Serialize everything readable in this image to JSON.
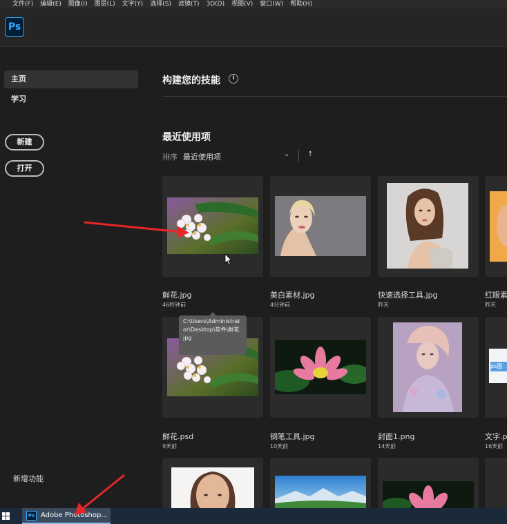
{
  "menu": {
    "items": [
      "文件(F)",
      "编辑(E)",
      "图像(I)",
      "图层(L)",
      "文字(Y)",
      "选择(S)",
      "滤镜(T)",
      "3D(D)",
      "视图(V)",
      "窗口(W)",
      "帮助(H)"
    ]
  },
  "app": {
    "logo_text": "Ps"
  },
  "sidebar": {
    "home": "主页",
    "learn": "学习",
    "new_button": "新建",
    "open_button": "打开",
    "whats_new": "新增功能"
  },
  "main": {
    "skills_heading": "构建您的技能",
    "info_glyph": "i",
    "recent_heading": "最近使用项",
    "sort_label": "排序",
    "sort_value": "最近使用项",
    "sort_chevron": "⌄",
    "sort_direction": "↑"
  },
  "recent_files": [
    {
      "name": "鲜花.jpg",
      "time": "46秒钟前"
    },
    {
      "name": "美白素材.jpg",
      "time": "4分钟前"
    },
    {
      "name": "快速选择工具.jpg",
      "time": "昨天"
    },
    {
      "name": "红眼素",
      "time": "昨天"
    },
    {
      "name": "鲜花.psd",
      "time": "9天前"
    },
    {
      "name": "钢笔工具.jpg",
      "time": "10天前"
    },
    {
      "name": "封面1.png",
      "time": "14天前"
    },
    {
      "name": "文字.p",
      "time": "16天前"
    }
  ],
  "partial_thumb_text": "ps图",
  "tooltip": {
    "path": "C:\\Users\\Administrator\\Desktop\\软件\\鲜花.jpg"
  },
  "taskbar": {
    "app_icon_text": "Ps",
    "app_label": "Adobe Photoshop..."
  },
  "colors": {
    "ps_blue": "#31a8ff",
    "annotation_red": "#e8262a",
    "background": "#1e1e1f"
  }
}
